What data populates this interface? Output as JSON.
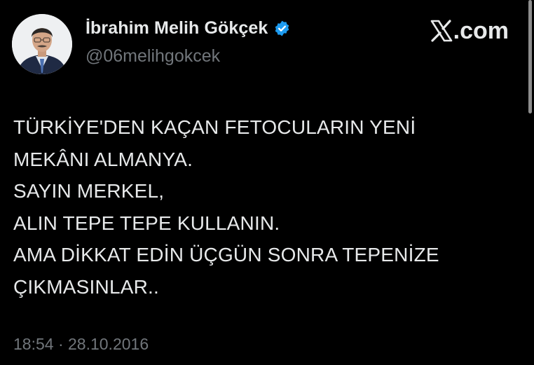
{
  "author": {
    "display_name": "İbrahim Melih Gökçek",
    "handle": "@06melihgokcek",
    "verified": true,
    "verified_color": "#1d9bf0"
  },
  "site": {
    "logo": "x-logo-icon",
    "suffix": ".com"
  },
  "tweet": {
    "lines": [
      "TÜRKİYE'DEN KAÇAN FETOCULARIN YENİ",
      "MEKÂNI ALMANYA.",
      "SAYIN MERKEL,",
      "ALIN TEPE TEPE KULLANIN.",
      "AMA DİKKAT EDİN ÜÇGÜN SONRA TEPENİZE",
      "ÇIKMASINLAR.."
    ],
    "timestamp": "18:54 · 28.10.2016"
  },
  "colors": {
    "background": "#000000",
    "primary_text": "#e7e9ea",
    "secondary_text": "#71767b"
  }
}
